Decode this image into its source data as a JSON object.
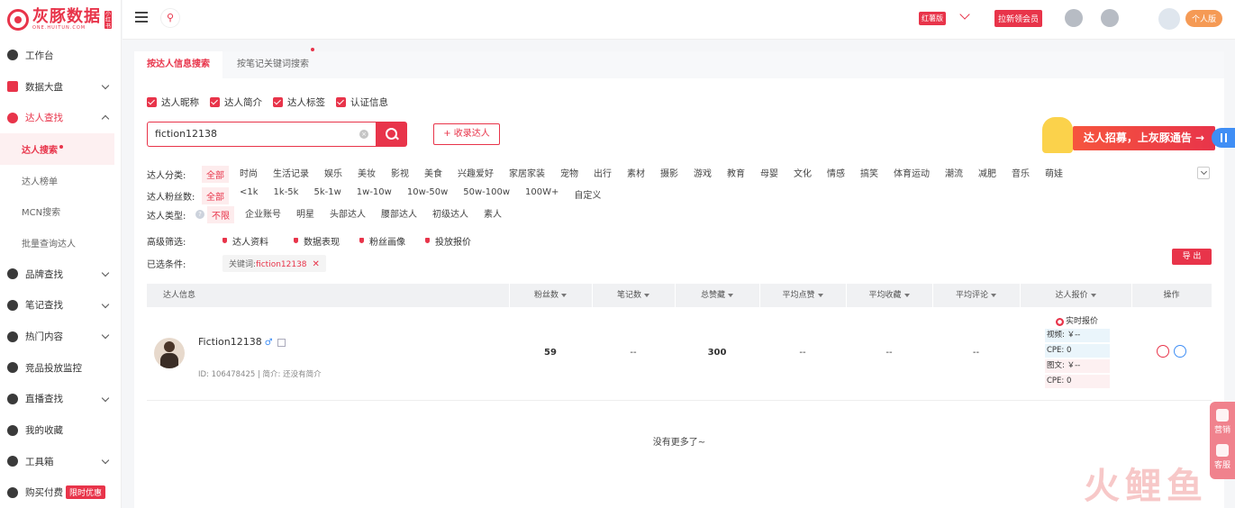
{
  "brand": {
    "name": "灰豚数据",
    "sub": "ONE.HUITUN.COM",
    "tag": "小红书"
  },
  "sidebar": {
    "items": [
      {
        "label": "工作台"
      },
      {
        "label": "数据大盘"
      },
      {
        "label": "达人查找"
      },
      {
        "label": "达人搜索"
      },
      {
        "label": "达人榜单"
      },
      {
        "label": "MCN搜索"
      },
      {
        "label": "批量查询达人"
      },
      {
        "label": "品牌查找"
      },
      {
        "label": "笔记查找"
      },
      {
        "label": "热门内容"
      },
      {
        "label": "竞品投放监控"
      },
      {
        "label": "直播查找"
      },
      {
        "label": "我的收藏"
      },
      {
        "label": "工具箱"
      },
      {
        "label": "购买付费"
      }
    ],
    "promo_badge": "限时优惠"
  },
  "topbar": {
    "version_badge": "红薯版",
    "invite": "拉新领会员",
    "personal": "个人版"
  },
  "tabs": [
    {
      "label": "按达人信息搜索"
    },
    {
      "label": "按笔记关键词搜索"
    }
  ],
  "checks": [
    {
      "label": "达人昵称"
    },
    {
      "label": "达人简介"
    },
    {
      "label": "达人标签"
    },
    {
      "label": "认证信息"
    }
  ],
  "search": {
    "value": "fiction12138",
    "collect_label": "+ 收录达人"
  },
  "banner": {
    "text": "达人招募，上灰豚通告 →"
  },
  "filters": {
    "category_label": "达人分类:",
    "categories": [
      "全部",
      "时尚",
      "生活记录",
      "娱乐",
      "美妆",
      "影视",
      "美食",
      "兴趣爱好",
      "家居家装",
      "宠物",
      "出行",
      "素材",
      "摄影",
      "游戏",
      "教育",
      "母婴",
      "文化",
      "情感",
      "搞笑",
      "体育运动",
      "潮流",
      "减肥",
      "音乐",
      "萌娃"
    ],
    "fans_label": "达人粉丝数:",
    "fans": [
      "全部",
      "<1k",
      "1k-5k",
      "5k-1w",
      "1w-10w",
      "10w-50w",
      "50w-100w",
      "100W+",
      "自定义"
    ],
    "type_label": "达人类型:",
    "types": [
      "不限",
      "企业账号",
      "明星",
      "头部达人",
      "腰部达人",
      "初级达人",
      "素人"
    ],
    "advanced_label": "高级筛选:",
    "advanced": [
      "达人资料",
      "数据表现",
      "粉丝画像",
      "投放报价"
    ],
    "selected_label": "已选条件:",
    "chip_key": "关键词:",
    "chip_value": "fiction12138",
    "export": "导 出"
  },
  "table": {
    "headers": [
      "达人信息",
      "粉丝数",
      "笔记数",
      "总赞藏",
      "平均点赞",
      "平均收藏",
      "平均评论",
      "达人报价",
      "操作"
    ],
    "rows": [
      {
        "name": "Fiction12138",
        "gender": "♂",
        "id_intro": "ID: 106478425 | 简介: 还没有简介",
        "fans": "59",
        "notes": "--",
        "likes": "300",
        "avg_like": "--",
        "avg_collect": "--",
        "avg_comment": "--",
        "quote_title": "实时报价",
        "video": "视频: ￥--",
        "cpe1": "CPE: 0",
        "image": "图文: ￥--",
        "cpe2": "CPE: 0"
      }
    ],
    "empty": "没有更多了~"
  },
  "float": {
    "marketing": "营销",
    "service": "客服"
  },
  "watermark": "火鲤鱼",
  "colors": {
    "accent": "#e8344a",
    "blue": "#3f8ef5"
  }
}
